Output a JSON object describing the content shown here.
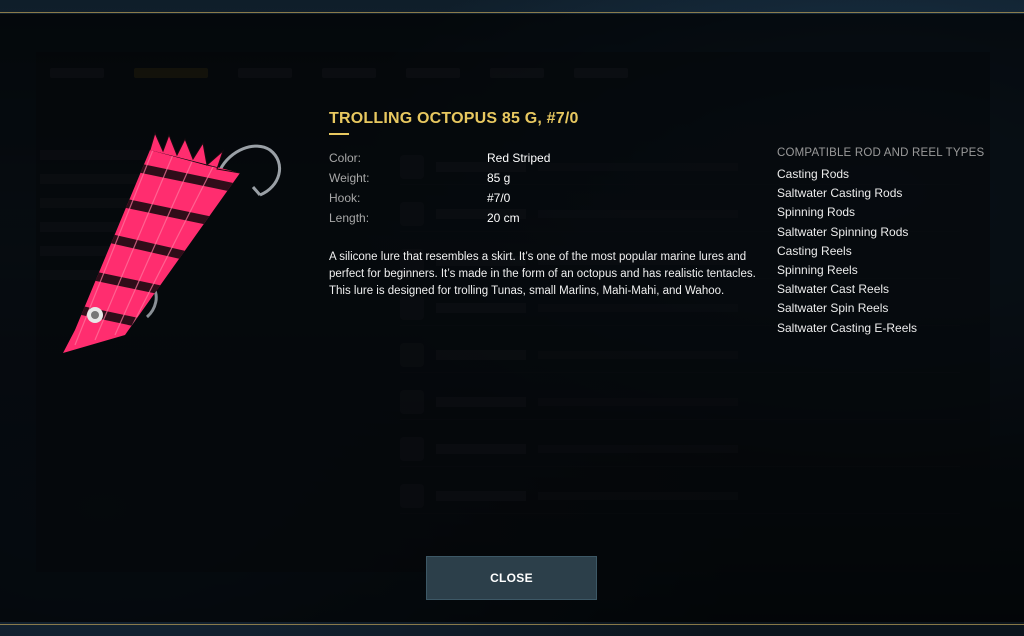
{
  "item": {
    "title": "TROLLING OCTOPUS 85 G, #7/0",
    "properties": [
      {
        "label": "Color:",
        "value": "Red Striped"
      },
      {
        "label": "Weight:",
        "value": "85 g"
      },
      {
        "label": "Hook:",
        "value": "#7/0"
      },
      {
        "label": "Length:",
        "value": "20 cm"
      }
    ],
    "description": "A silicone lure that resembles a skirt. It’s one of the most popular marine lures and perfect for beginners. It’s made in the form of an octopus and has realistic tentacles. This lure is designed for trolling Tunas, small Marlins, Mahi-Mahi, and Wahoo."
  },
  "compatible": {
    "title": "COMPATIBLE ROD AND REEL TYPES",
    "items": [
      "Casting Rods",
      "Saltwater Casting Rods",
      "Spinning Rods",
      "Saltwater Spinning Rods",
      "Casting Reels",
      "Spinning Reels",
      "Saltwater Cast Reels",
      "Saltwater Spin Reels",
      "Saltwater Casting E-Reels"
    ]
  },
  "close_label": "CLOSE",
  "colors": {
    "accent": "#e8c860",
    "lure_pink": "#ff2d6f",
    "lure_stripe": "#1a0b10",
    "button_bg": "#2c3f4a"
  }
}
